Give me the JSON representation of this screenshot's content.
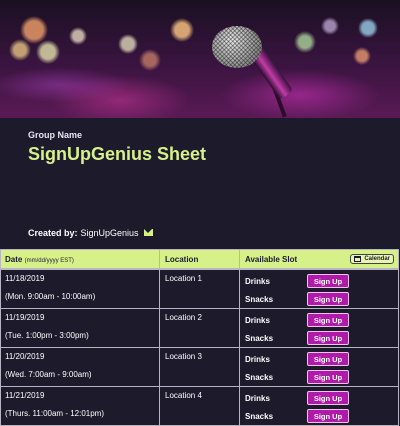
{
  "header": {
    "group_label": "Group Name",
    "title": "SignUpGenius Sheet",
    "created_by_label": "Created by:",
    "created_by_name": "SignUpGenius"
  },
  "table": {
    "col_date": "Date",
    "col_date_format": "(mm/dd/yyyy EST)",
    "col_location": "Location",
    "col_slot": "Available Slot",
    "calendar_label": "Calendar",
    "rows": [
      {
        "date": "11/18/2019",
        "time": "(Mon. 9:00am - 10:00am)",
        "location": "Location 1",
        "slots": [
          {
            "name": "Drinks",
            "button": "Sign Up"
          },
          {
            "name": "Snacks",
            "button": "Sign Up"
          }
        ]
      },
      {
        "date": "11/19/2019",
        "time": "(Tue. 1:00pm - 3:00pm)",
        "location": "Location 2",
        "slots": [
          {
            "name": "Drinks",
            "button": "Sign Up"
          },
          {
            "name": "Snacks",
            "button": "Sign Up"
          }
        ]
      },
      {
        "date": "11/20/2019",
        "time": "(Wed. 7:00am - 9:00am)",
        "location": "Location 3",
        "slots": [
          {
            "name": "Drinks",
            "button": "Sign Up"
          },
          {
            "name": "Snacks",
            "button": "Sign Up"
          }
        ]
      },
      {
        "date": "11/21/2019",
        "time": "(Thurs. 11:00am - 12:01pm)",
        "location": "Location 4",
        "slots": [
          {
            "name": "Drinks",
            "button": "Sign Up"
          },
          {
            "name": "Snacks",
            "button": "Sign Up"
          }
        ]
      }
    ]
  },
  "colors": {
    "background": "#1d1a2b",
    "accent": "#d6f08a",
    "signup_button": "#b01aa8"
  },
  "icons": {
    "banner": "microphone-photo",
    "email": "mail-icon",
    "calendar": "calendar-icon"
  }
}
